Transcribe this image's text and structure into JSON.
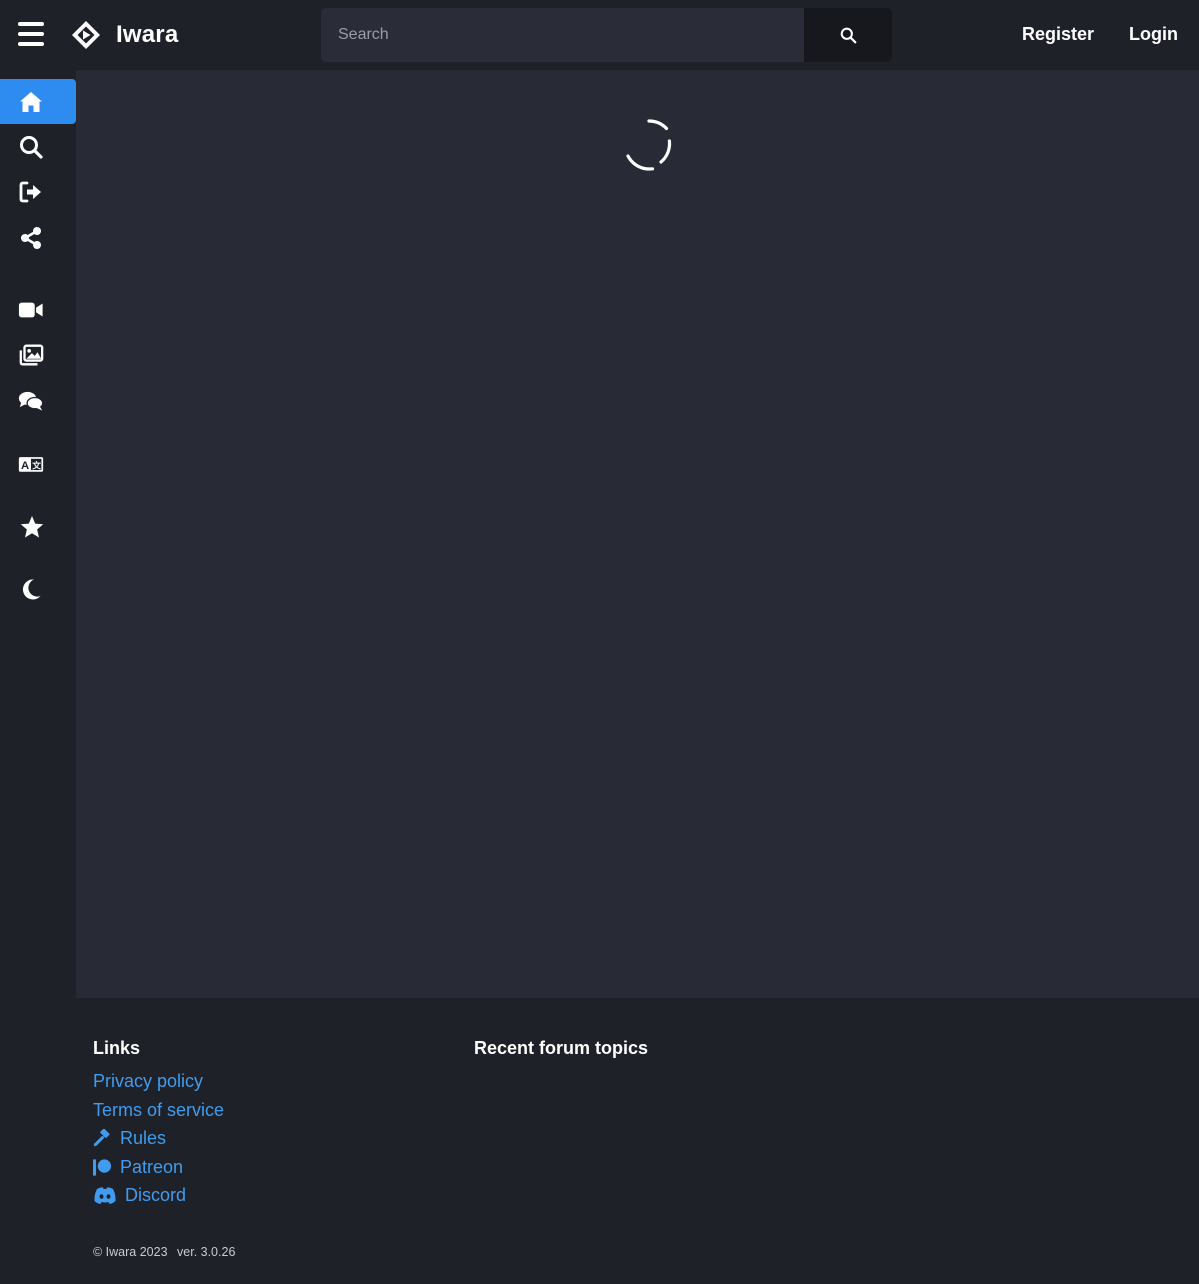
{
  "header": {
    "logo_text": "Iwara",
    "search_placeholder": "Search",
    "register_label": "Register",
    "login_label": "Login"
  },
  "sidebar": {
    "items": [
      {
        "icon": "home-icon",
        "active": true
      },
      {
        "icon": "search-icon",
        "active": false
      },
      {
        "icon": "login-icon",
        "active": false
      },
      {
        "icon": "share-icon",
        "active": false
      },
      {
        "icon": "video-icon",
        "active": false
      },
      {
        "icon": "images-icon",
        "active": false
      },
      {
        "icon": "forum-icon",
        "active": false
      },
      {
        "icon": "translate-icon",
        "active": false
      },
      {
        "icon": "star-icon",
        "active": false
      },
      {
        "icon": "moon-icon",
        "active": false
      }
    ]
  },
  "footer": {
    "links_heading": "Links",
    "forum_heading": "Recent forum topics",
    "links": [
      {
        "label": "Privacy policy",
        "icon": null
      },
      {
        "label": "Terms of service",
        "icon": null
      },
      {
        "label": "Rules",
        "icon": "gavel-icon"
      },
      {
        "label": "Patreon",
        "icon": "patreon-icon"
      },
      {
        "label": "Discord",
        "icon": "discord-icon"
      }
    ],
    "copyright": "© Iwara 2023",
    "version": "ver. 3.0.26"
  },
  "colors": {
    "accent": "#2e8bf0",
    "link": "#3f9cf0",
    "background": "#1f2129",
    "content_background": "#282b35"
  }
}
